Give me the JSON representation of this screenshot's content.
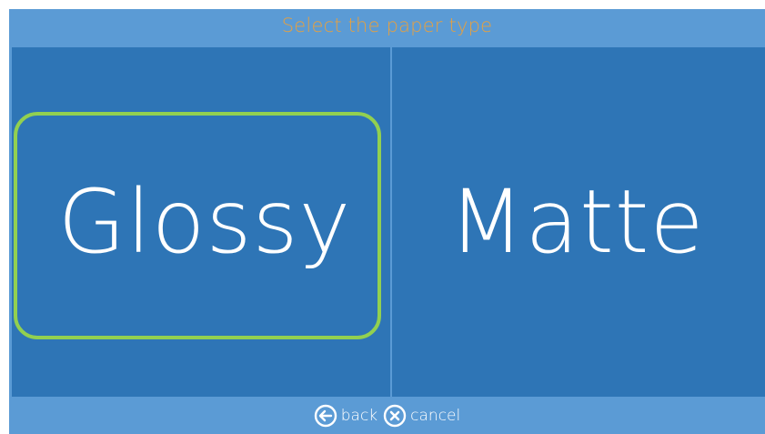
{
  "header": {
    "title": "Select the paper type"
  },
  "options": [
    {
      "label": "Glossy",
      "selected": true
    },
    {
      "label": "Matte",
      "selected": false
    }
  ],
  "footer": {
    "back_label": "back",
    "cancel_label": "cancel",
    "back_icon": "arrow-left-circle-icon",
    "cancel_icon": "x-circle-icon"
  },
  "colors": {
    "panel_background": "#5b9bd5",
    "tile_background": "#2e75b6",
    "title_color": "#e6a040",
    "selection_color": "#92d050",
    "text_color": "#ffffff"
  }
}
